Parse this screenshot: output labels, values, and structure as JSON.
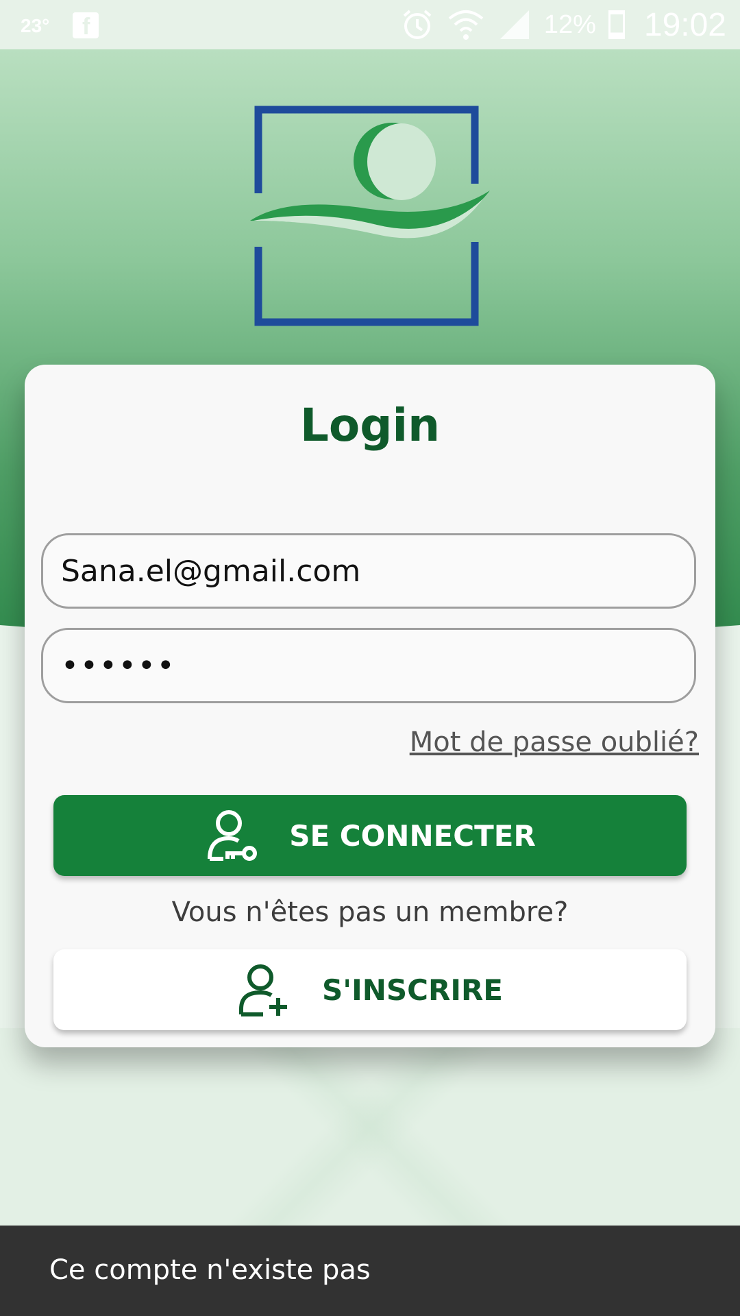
{
  "status_bar": {
    "temperature": "23°",
    "battery_percent": "12%",
    "time": "19:02",
    "icons": [
      "facebook-icon",
      "alarm-icon",
      "wifi-icon",
      "signal-icon",
      "battery-icon"
    ]
  },
  "login": {
    "title": "Login",
    "email_value": "Sana.el@gmail.com",
    "password_value": "••••••",
    "forgot_password": "Mot de passe oublié?",
    "connect_label": "SE CONNECTER",
    "member_prompt": "Vous n'êtes pas un membre?",
    "signup_label": "S'INSCRIRE"
  },
  "snackbar": {
    "message": "Ce compte n'existe pas"
  },
  "colors": {
    "primary_green": "#15813a",
    "dark_green": "#0f5a2b",
    "logo_blue": "#1e4b9b",
    "snackbar_bg": "#323232"
  }
}
